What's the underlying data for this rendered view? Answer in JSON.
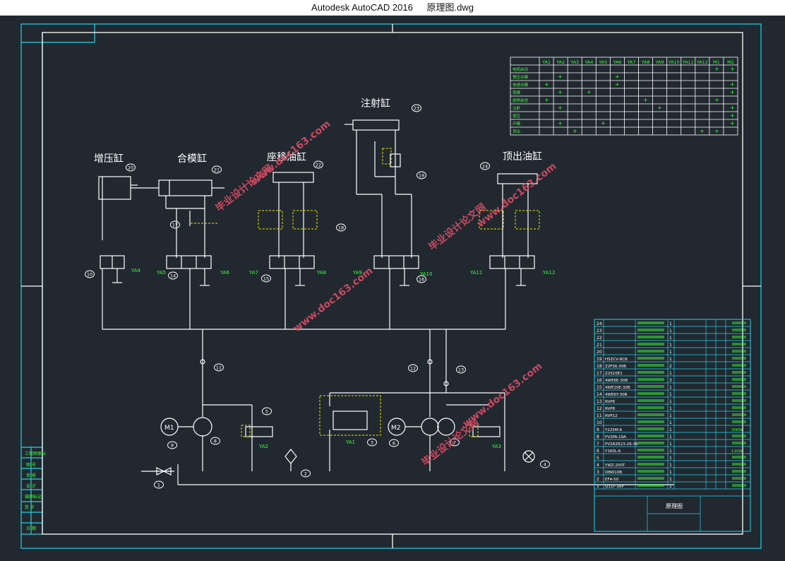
{
  "window": {
    "app_title": "Autodesk AutoCAD 2016",
    "file_name": "原理图.dwg"
  },
  "colors": {
    "background": "#212830",
    "line": "#ffffff",
    "frame": "#22d3e6",
    "label": "#3bff3b",
    "callout": "#e6e600",
    "watermark": "#e8506a"
  },
  "cylinders": {
    "booster": "增压缸",
    "clamp": "合模缸",
    "shift": "座移油缸",
    "injection": "注射缸",
    "ejector": "顶出油缸"
  },
  "valves": {
    "ya4": "YA4",
    "ya5": "YA5",
    "ya6": "YA6",
    "ya7": "YA7",
    "ya8": "YA8",
    "ya9": "YA9",
    "ya10": "YA10",
    "ya11": "YA11",
    "ya12": "YA12",
    "ya1": "YA1",
    "ya2": "YA2",
    "ya3": "YA3"
  },
  "motors": {
    "m1": "M1",
    "m2": "M2"
  },
  "balloons": [
    "1",
    "2",
    "3",
    "4",
    "5",
    "6",
    "7",
    "8",
    "9",
    "10",
    "11",
    "12",
    "13",
    "14",
    "15",
    "16",
    "17",
    "18",
    "19",
    "20",
    "21",
    "22",
    "23",
    "24"
  ],
  "solenoid_table": {
    "headers": [
      "YA1",
      "YA2",
      "YA3",
      "YA4",
      "YA5",
      "YA6",
      "YA7",
      "YA8",
      "YA9",
      "YA10",
      "YA11",
      "YA12",
      "M1",
      "M2"
    ]
  },
  "parts_list": {
    "rows": [
      {
        "no": "24",
        "code": "",
        "qty": "1",
        "note": ""
      },
      {
        "no": "23",
        "code": "",
        "qty": "1",
        "note": ""
      },
      {
        "no": "22",
        "code": "",
        "qty": "1",
        "note": ""
      },
      {
        "no": "21",
        "code": "",
        "qty": "1",
        "note": ""
      },
      {
        "no": "20",
        "code": "",
        "qty": "1",
        "note": ""
      },
      {
        "no": "19",
        "code": "HSZCV-8CB",
        "qty": "1",
        "note": ""
      },
      {
        "no": "18",
        "code": "Z2FS6-30B",
        "qty": "2",
        "note": ""
      },
      {
        "no": "17",
        "code": "Z2S10E1",
        "qty": "1",
        "note": ""
      },
      {
        "no": "16",
        "code": "4WE6E-30B",
        "qty": "3",
        "note": ""
      },
      {
        "no": "15",
        "code": "4WE10E-30B",
        "qty": "1",
        "note": ""
      },
      {
        "no": "14",
        "code": "4WE6Y-30B",
        "qty": "1",
        "note": ""
      },
      {
        "no": "13",
        "code": "RVP6",
        "qty": "1",
        "note": ""
      },
      {
        "no": "12",
        "code": "RVP8",
        "qty": "1",
        "note": ""
      },
      {
        "no": "11",
        "code": "RVP12",
        "qty": "1",
        "note": ""
      },
      {
        "no": "10",
        "code": "",
        "qty": "1",
        "note": ""
      },
      {
        "no": "9",
        "code": "Y225M-6",
        "qty": "1",
        "note": "30KW"
      },
      {
        "no": "8",
        "code": "PV2PA-19A",
        "qty": "1",
        "note": ""
      },
      {
        "no": "7",
        "code": "PV2R2R23-26-36",
        "qty": "1",
        "note": ""
      },
      {
        "no": "6",
        "code": "Y160L-6",
        "qty": "1",
        "note": "11KW"
      },
      {
        "no": "5",
        "code": "",
        "qty": "1",
        "note": ""
      },
      {
        "no": "4",
        "code": "YWZ-200T",
        "qty": "1",
        "note": ""
      },
      {
        "no": "3",
        "code": "DBW10B",
        "qty": "1",
        "note": ""
      },
      {
        "no": "2",
        "code": "EF4-50",
        "qty": "1",
        "note": ""
      },
      {
        "no": "1",
        "code": "Q11F-16P",
        "qty": "1",
        "note": ""
      }
    ],
    "drawing_title": "原理图"
  }
}
